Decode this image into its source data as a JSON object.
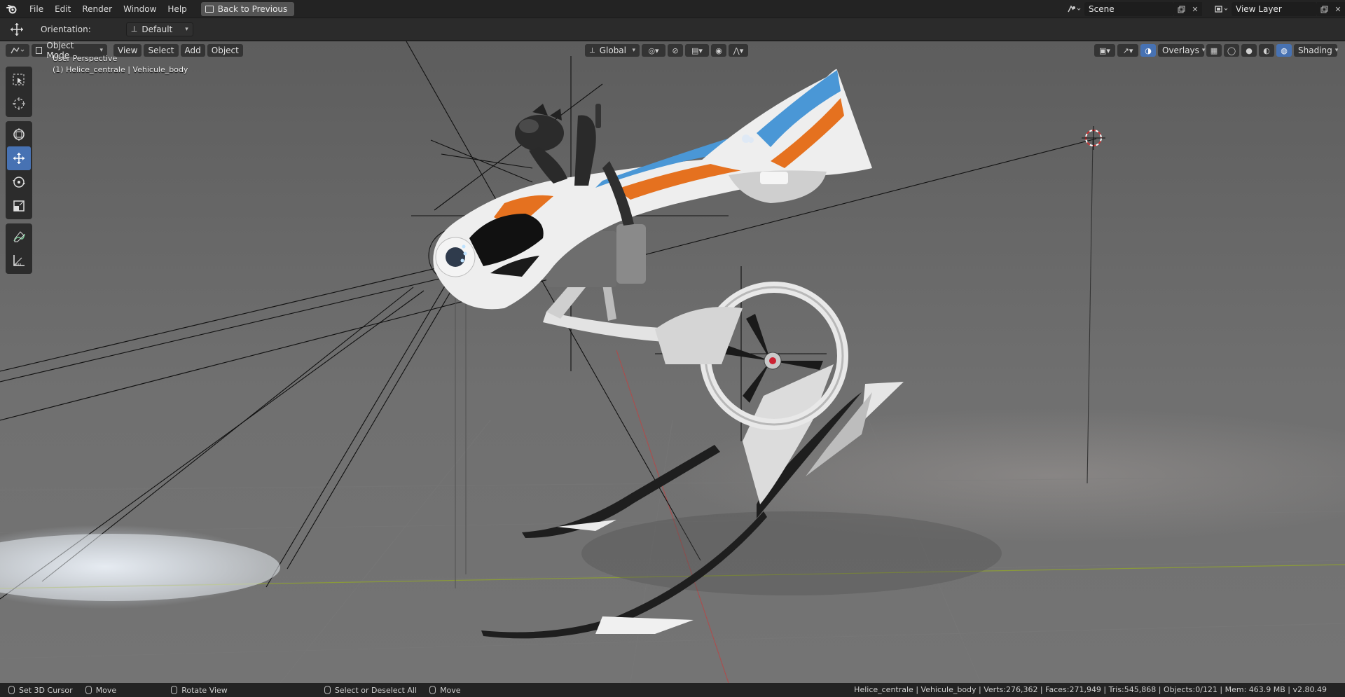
{
  "topbar": {
    "menus": [
      "File",
      "Edit",
      "Render",
      "Window",
      "Help"
    ],
    "back_button": "Back to Previous",
    "scene_name": "Scene",
    "view_layer": "View Layer"
  },
  "tool_settings": {
    "orientation_label": "Orientation:",
    "orientation_value": "Default"
  },
  "viewport_header": {
    "mode": "Object Mode",
    "menus": [
      "View",
      "Select",
      "Add",
      "Object"
    ],
    "transform_orientation": "Global",
    "overlays": "Overlays",
    "shading": "Shading"
  },
  "viewport_info": {
    "perspective": "User Perspective",
    "active_object": "(1) Helice_centrale | Vehicule_body"
  },
  "tools": [
    "select-box-tool",
    "cursor-tool",
    "move-tool",
    "transform-tool",
    "rotate-tool",
    "scale-tool",
    "annotate-tool",
    "measure-tool"
  ],
  "statusbar": {
    "set_cursor": "Set 3D Cursor",
    "move1": "Move",
    "rotate_view": "Rotate View",
    "select_all": "Select or Deselect All",
    "move2": "Move",
    "stats": "Helice_centrale | Vehicule_body | Verts:276,362 | Faces:271,949 | Tris:545,868 | Objects:0/121 | Mem: 463.9 MB | v2.80.49"
  },
  "colors": {
    "accent": "#4772b3",
    "vehicle_orange": "#e5711f",
    "vehicle_blue": "#4a97d6"
  }
}
